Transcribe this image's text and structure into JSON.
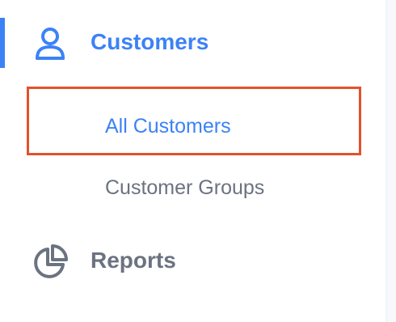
{
  "sidebar": {
    "customers": {
      "label": "Customers",
      "icon": "user-icon",
      "active": true,
      "children": [
        {
          "label": "All Customers",
          "active": true
        },
        {
          "label": "Customer Groups",
          "active": false
        }
      ]
    },
    "reports": {
      "label": "Reports",
      "icon": "pie-chart-icon"
    }
  },
  "colors": {
    "accent": "#3b82f6",
    "muted": "#6b7280",
    "highlight": "#e2512d"
  }
}
